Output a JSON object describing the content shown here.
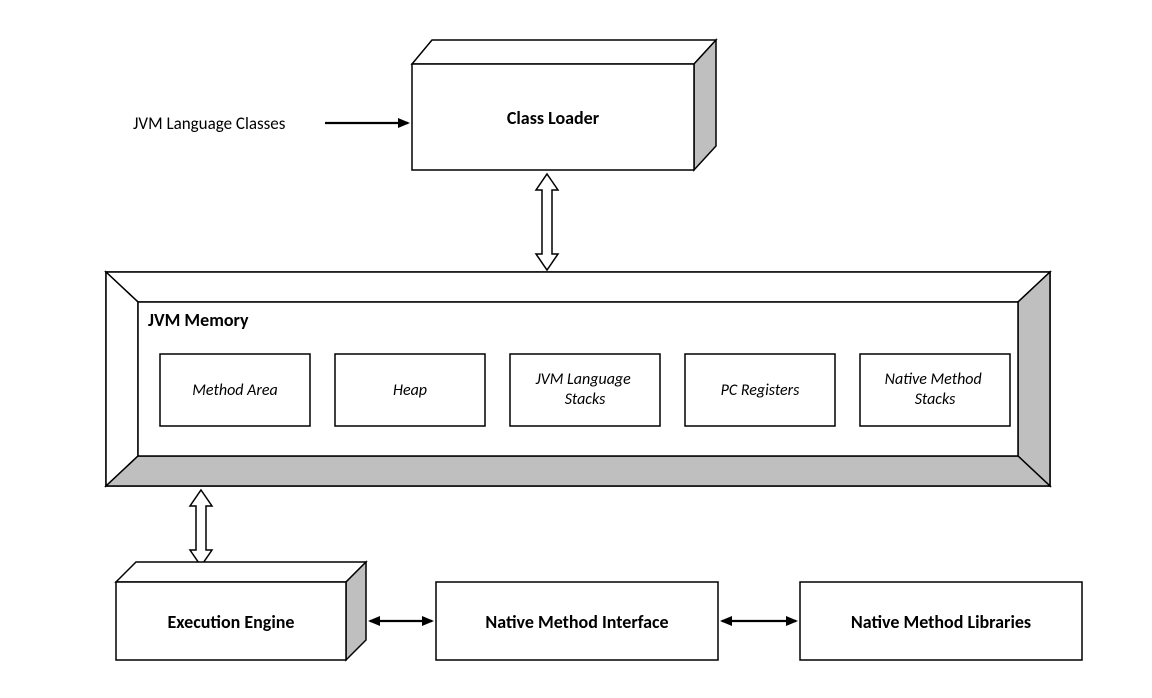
{
  "diagram": {
    "input_label": "JVM Language Classes",
    "class_loader": "Class Loader",
    "memory": {
      "title": "JVM Memory",
      "items": [
        "Method Area",
        "Heap",
        "JVM Language Stacks",
        "PC Registers",
        "Native Method Stacks"
      ]
    },
    "execution_engine": "Execution Engine",
    "native_method_interface": "Native Method Interface",
    "native_method_libraries": "Native Method Libraries"
  }
}
